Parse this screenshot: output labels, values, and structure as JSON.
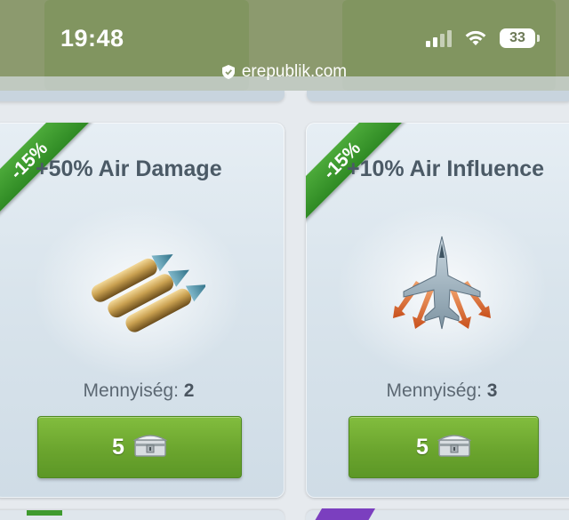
{
  "status_bar": {
    "time": "19:48",
    "battery_level": "33",
    "icons": [
      "signal-icon",
      "wifi-icon",
      "battery-icon"
    ]
  },
  "browser": {
    "url": "erepublik.com",
    "lock_icon": "shield-icon"
  },
  "offers": [
    {
      "discount": "-15%",
      "title": "+50% Air Damage",
      "icon": "bullets-icon",
      "quantity_label": "Mennyiség:",
      "quantity": "2",
      "price": "5",
      "currency_icon": "chest-icon"
    },
    {
      "discount": "-15%",
      "title": "+10% Air Influence",
      "icon": "jet-fighter-icon",
      "quantity_label": "Mennyiség:",
      "quantity": "3",
      "price": "5",
      "currency_icon": "chest-icon"
    }
  ],
  "colors": {
    "accent_green": "#6ba52e",
    "ribbon_green": "#3a9a2c",
    "title_text": "#4b5a66",
    "chrome_olive": "#8c9a6e"
  }
}
